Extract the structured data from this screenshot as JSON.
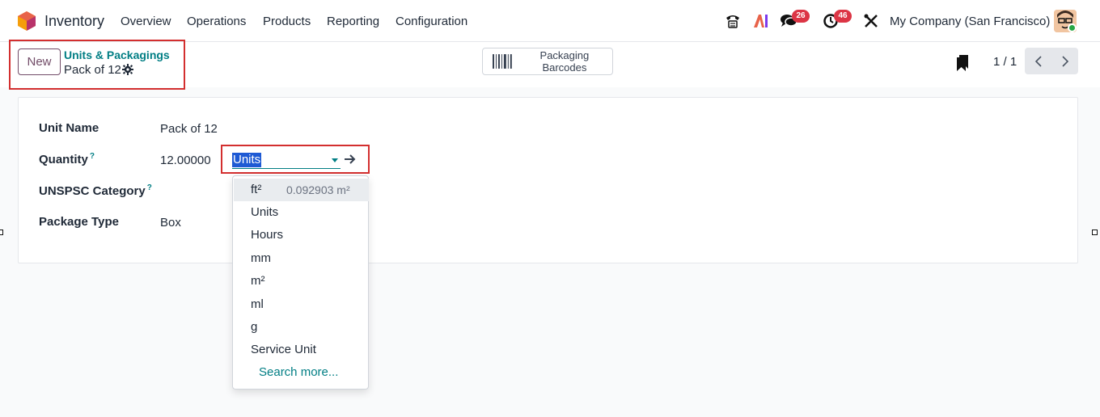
{
  "navbar": {
    "app_name": "Inventory",
    "menu": [
      "Overview",
      "Operations",
      "Products",
      "Reporting",
      "Configuration"
    ],
    "discuss_count": "26",
    "activity_count": "46",
    "company": "My Company (San Francisco)",
    "icons": [
      "phone-icon",
      "ai-icon",
      "chat-icon",
      "clock-icon",
      "tools-icon"
    ]
  },
  "control_panel": {
    "new_label": "New",
    "breadcrumb": "Units & Packagings",
    "record_title": "Pack of 12",
    "barcode_button": "Packaging Barcodes",
    "pager": "1 / 1"
  },
  "form": {
    "unit_name_label": "Unit Name",
    "unit_name_value": "Pack of 12",
    "quantity_label": "Quantity",
    "quantity_value": "12.00000",
    "uom_value": "Units",
    "unspsc_label": "UNSPSC Category",
    "package_type_label": "Package Type",
    "package_type_value": "Box",
    "help_mark": "?"
  },
  "dropdown": {
    "items": [
      {
        "label": "ft²",
        "extra": "0.092903 m²"
      },
      {
        "label": "Units"
      },
      {
        "label": "Hours"
      },
      {
        "label": "mm"
      },
      {
        "label": "m²"
      },
      {
        "label": "ml"
      },
      {
        "label": "g"
      },
      {
        "label": "Service Unit"
      }
    ],
    "search_more": "Search more..."
  },
  "colors": {
    "brand": "#714b67",
    "accent": "#017e84",
    "badge": "#dc3545",
    "highlight": "#d32f2f"
  }
}
